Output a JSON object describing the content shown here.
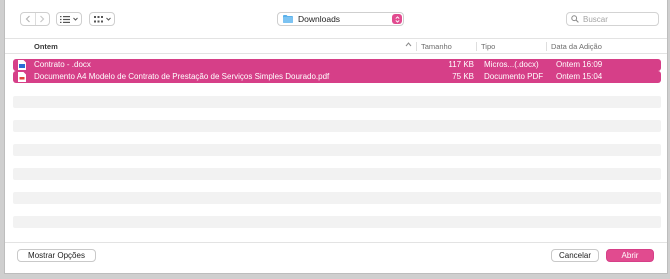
{
  "toolbar": {
    "back_icon": "chevron-left-icon",
    "forward_icon": "chevron-right-icon",
    "list_view_icon": "list-icon",
    "grid_view_icon": "grid-icon",
    "location": {
      "label": "Downloads",
      "icon": "folder-icon"
    },
    "search": {
      "placeholder": "Buscar",
      "value": ""
    }
  },
  "columns": {
    "name": "Ontem",
    "size": "Tamanho",
    "type": "Tipo",
    "date": "Data da Adição"
  },
  "files": [
    {
      "name": "Contrato - .docx",
      "size": "117 KB",
      "type": "Micros...(.docx)",
      "date": "Ontem 16:09",
      "selected": true,
      "icon": "word-document-icon"
    },
    {
      "name": "Documento A4 Modelo de Contrato de Prestação de Serviços Simples Dourado.pdf",
      "size": "75 KB",
      "type": "Documento PDF",
      "date": "Ontem 15:04",
      "selected": true,
      "icon": "pdf-document-icon"
    }
  ],
  "footer": {
    "options_label": "Mostrar Opções",
    "cancel_label": "Cancelar",
    "open_label": "Abrir"
  },
  "colors": {
    "accent": "#e14b8f",
    "selection": "#d63f88"
  }
}
